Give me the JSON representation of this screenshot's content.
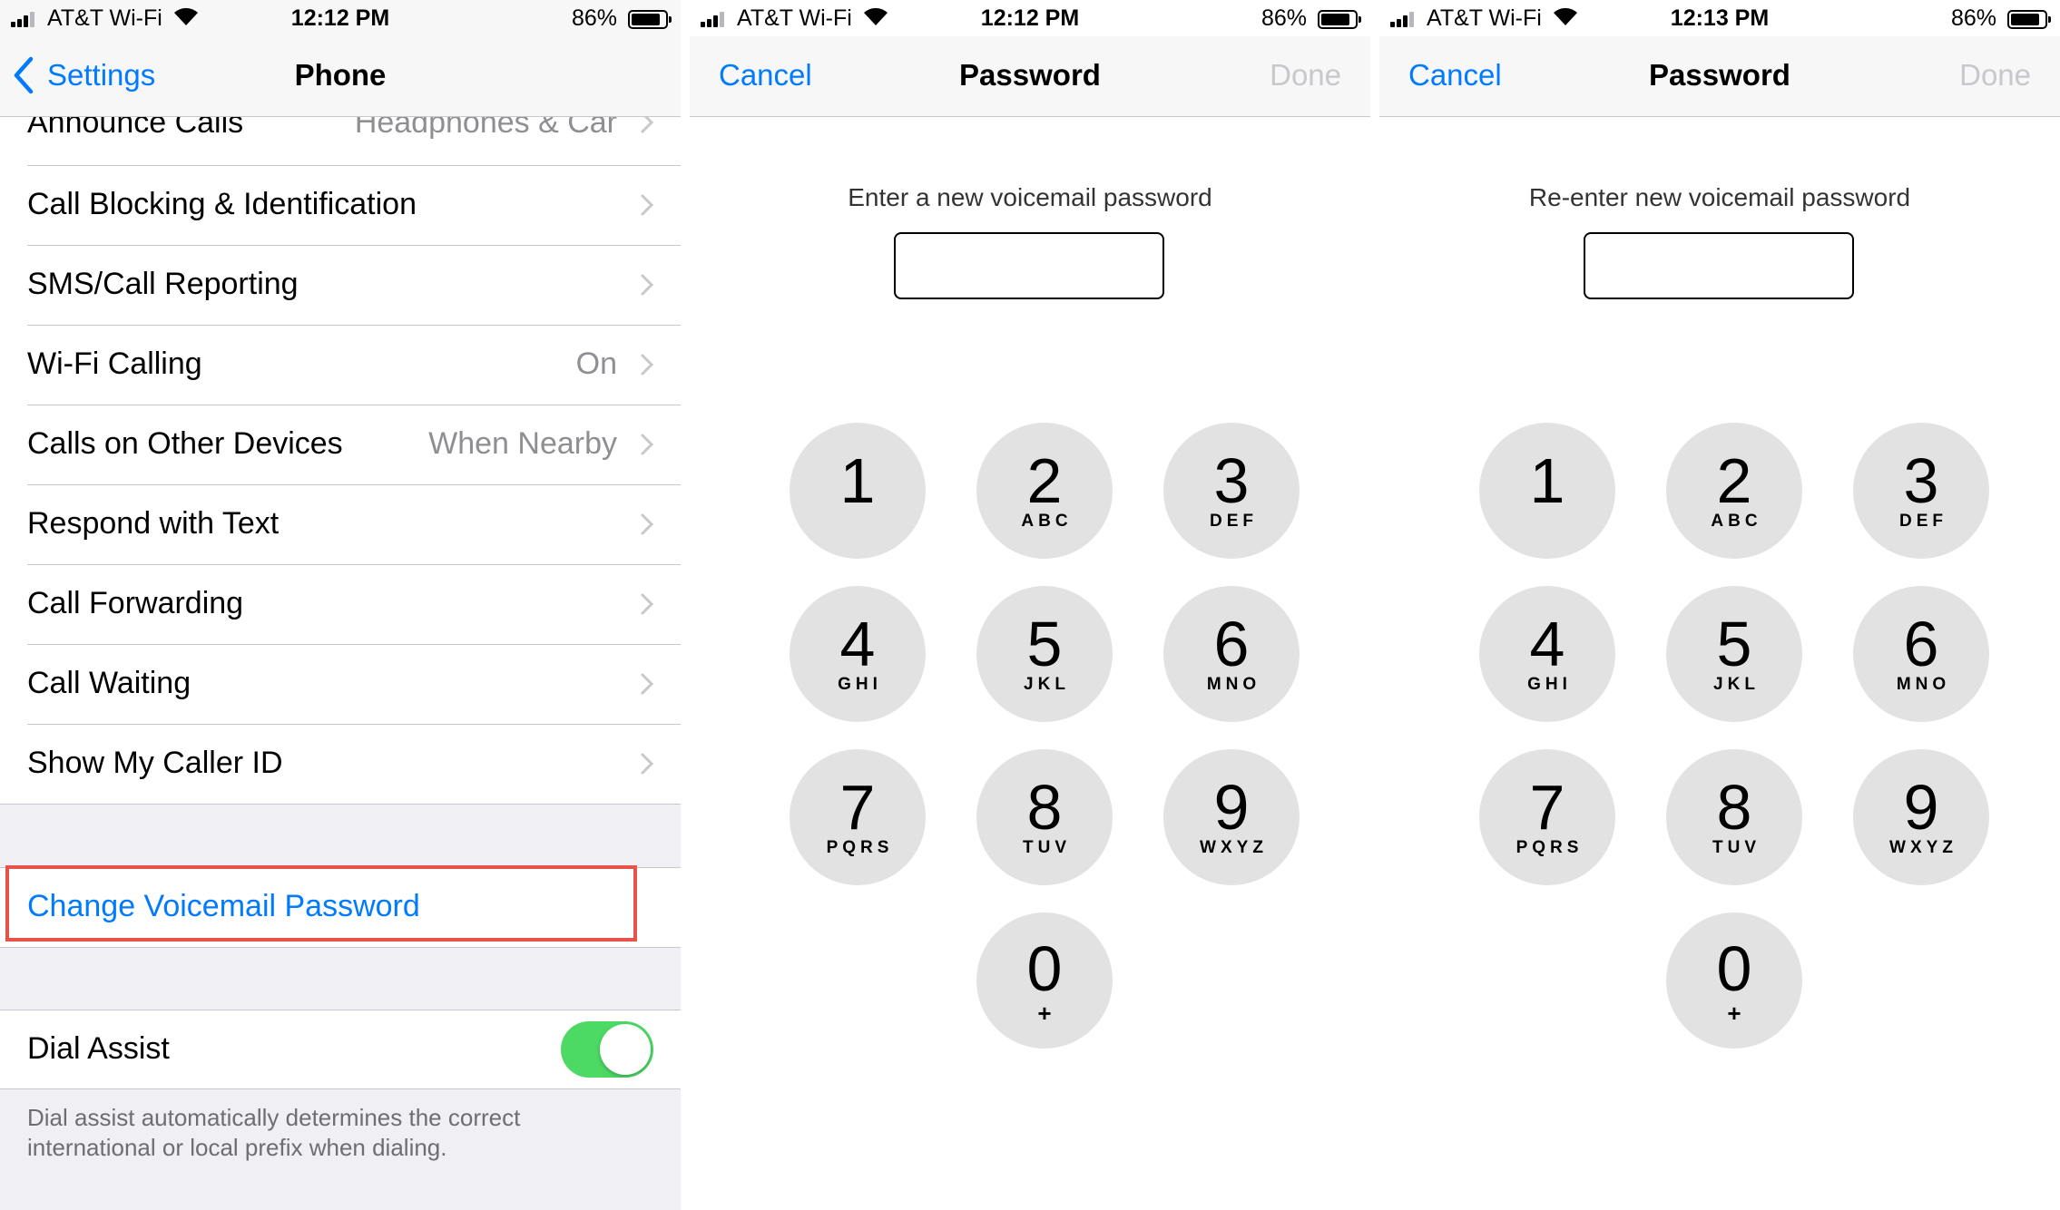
{
  "screens": {
    "phone_settings": {
      "status": {
        "carrier": "AT&T Wi-Fi",
        "time": "12:12 PM",
        "battery": "86%",
        "battery_level": 0.86
      },
      "nav": {
        "back_label": "Settings",
        "title": "Phone"
      },
      "rows": [
        {
          "label": "Announce Calls",
          "value": "Headphones & Car"
        },
        {
          "label": "Call Blocking & Identification",
          "value": ""
        },
        {
          "label": "SMS/Call Reporting",
          "value": ""
        },
        {
          "label": "Wi-Fi Calling",
          "value": "On"
        },
        {
          "label": "Calls on Other Devices",
          "value": "When Nearby"
        },
        {
          "label": "Respond with Text",
          "value": ""
        },
        {
          "label": "Call Forwarding",
          "value": ""
        },
        {
          "label": "Call Waiting",
          "value": ""
        },
        {
          "label": "Show My Caller ID",
          "value": ""
        }
      ],
      "change_voicemail_password": "Change Voicemail Password",
      "dial_assist": {
        "label": "Dial Assist",
        "enabled": true
      },
      "dial_assist_footnote": "Dial assist automatically determines the correct international or local prefix when dialing.",
      "colors": {
        "link": "#007aff",
        "highlight": "#e5534b",
        "toggle_on": "#4cd964"
      }
    },
    "password_new": {
      "status": {
        "carrier": "AT&T Wi-Fi",
        "time": "12:12 PM",
        "battery": "86%",
        "battery_level": 0.86
      },
      "nav": {
        "cancel": "Cancel",
        "title": "Password",
        "done": "Done"
      },
      "prompt": "Enter a new voicemail password",
      "password_value": ""
    },
    "password_reenter": {
      "status": {
        "carrier": "AT&T Wi-Fi",
        "time": "12:13 PM",
        "battery": "86%",
        "battery_level": 0.86
      },
      "nav": {
        "cancel": "Cancel",
        "title": "Password",
        "done": "Done"
      },
      "prompt": "Re-enter new voicemail password",
      "password_value": ""
    }
  },
  "keypad": [
    {
      "digit": "1",
      "letters": ""
    },
    {
      "digit": "2",
      "letters": "ABC"
    },
    {
      "digit": "3",
      "letters": "DEF"
    },
    {
      "digit": "4",
      "letters": "GHI"
    },
    {
      "digit": "5",
      "letters": "JKL"
    },
    {
      "digit": "6",
      "letters": "MNO"
    },
    {
      "digit": "7",
      "letters": "PQRS"
    },
    {
      "digit": "8",
      "letters": "TUV"
    },
    {
      "digit": "9",
      "letters": "WXYZ"
    },
    {
      "digit": "0",
      "letters": "+"
    }
  ]
}
